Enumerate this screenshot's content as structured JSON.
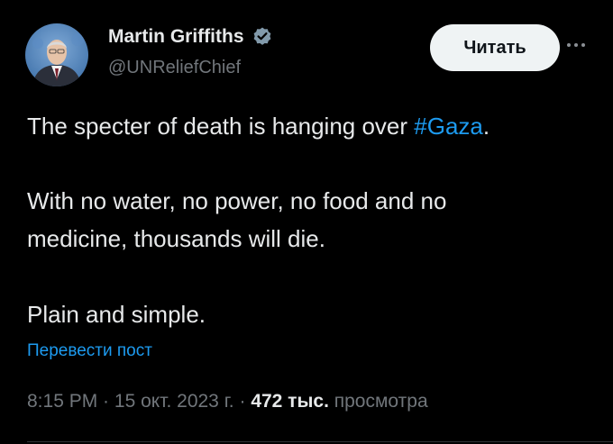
{
  "author": {
    "display_name": "Martin Griffiths",
    "handle": "@UNReliefChief",
    "verified": true
  },
  "actions": {
    "read_label": "Читать"
  },
  "tweet": {
    "line1_text": "The specter of death is hanging over ",
    "hashtag": "#Gaza",
    "line1_end": ".",
    "line2": "With no water, no power, no food and no",
    "line3": "medicine, thousands will die.",
    "line4": "Plain and simple."
  },
  "translate_label": "Перевести пост",
  "meta": {
    "time": "8:15 PM",
    "sep1": " · ",
    "date": "15 окт. 2023 г.",
    "sep2": " · ",
    "views_count": "472 тыс.",
    "views_label": " просмотра"
  },
  "colors": {
    "background": "#000000",
    "text": "#e7e9ea",
    "secondary": "#71767b",
    "accent": "#1d9bf0",
    "button_bg": "#eff3f4"
  },
  "icons": {
    "verified": "verified-badge-icon",
    "more": "more-dots-icon"
  }
}
